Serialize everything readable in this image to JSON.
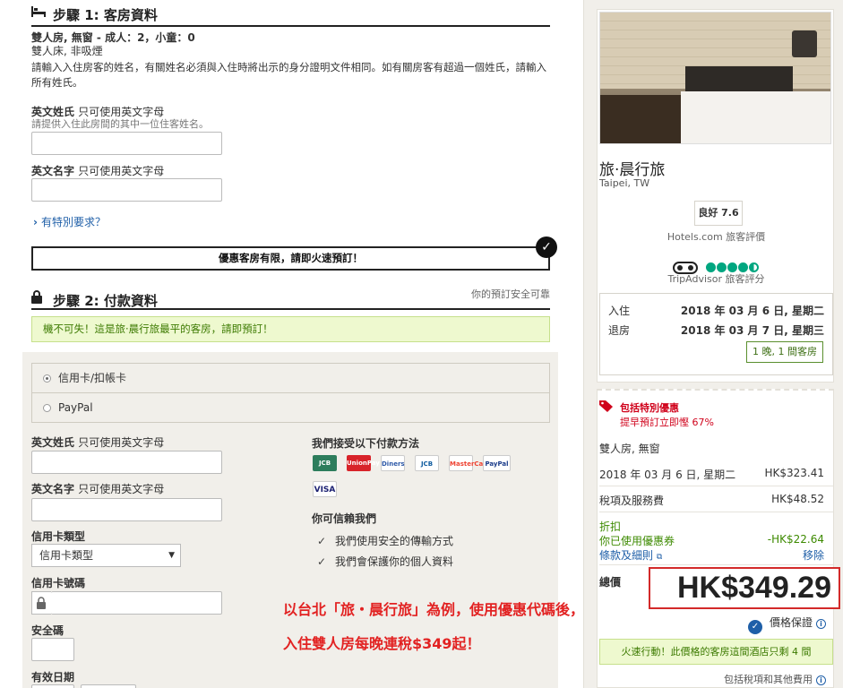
{
  "step1": {
    "title": "步驟 1: 客房資料",
    "room_title": "雙人房, 無窗 - 成人：2，小童：0",
    "room_bed": "雙人床, 非吸煙",
    "instruction": "請輸入入住房客的姓名，有關姓名必須與入住時將出示的身分證明文件相同。如有關房客有超過一個姓氏，請輸入所有姓氏。",
    "surname_label": "英文姓氏",
    "surname_sub": "只可使用英文字母",
    "surname_hint": "請提供入住此房間的其中一位住客姓名。",
    "givenname_label": "英文名字",
    "givenname_sub": "只可使用英文字母",
    "special_request": "有特別要求？",
    "promo_text": "優惠客房有限，請即火速預訂！"
  },
  "step2": {
    "title": "步驟 2: 付款資料",
    "secure_note": "你的預訂安全可靠",
    "green_note": "機不可失！這是旅·晨行旅最平的客房，請即預訂！",
    "option_card": "信用卡/扣帳卡",
    "option_paypal": "PayPal",
    "surname_label": "英文姓氏",
    "surname_sub": "只可使用英文字母",
    "givenname_label": "英文名字",
    "givenname_sub": "只可使用英文字母",
    "card_type_label": "信用卡類型",
    "card_type_value": "信用卡類型",
    "card_number_label": "信用卡號碼",
    "cvv_label": "安全碼",
    "expiry_label": "有效日期",
    "accept_title": "我們接受以下付款方法",
    "cards": [
      "JCB",
      "UnionPay",
      "Diners",
      "JCB",
      "MasterCard",
      "PayPal",
      "VISA"
    ],
    "trust_title": "你可信賴我們",
    "trust_items": [
      "我們使用安全的傳輸方式",
      "我們會保護你的個人資料"
    ]
  },
  "annotation": {
    "line1": "以台北「旅・晨行旅」為例，使用優惠代碼後，",
    "line2": "入住雙人房每晚連稅$349起！"
  },
  "hotel": {
    "name": "旅·晨行旅",
    "location": "Taipei, TW",
    "rating": "良好 7.6",
    "rating_source": "Hotels.com 旅客評價",
    "tripadvisor_source": "TripAdvisor 旅客評分",
    "tripadvisor_score": 4.5,
    "checkin_label": "入住",
    "checkin_value": "2018 年 03 月 6 日, 星期二",
    "checkout_label": "退房",
    "checkout_value": "2018 年 03 月 7 日, 星期三",
    "nights": "1 晚, 1 間客房"
  },
  "price": {
    "deal_title": "包括特別優惠",
    "deal_sub": "提早預訂立即慳 67%",
    "room": "雙人房, 無窗",
    "night_date": "2018 年 03 月 6 日, 星期二",
    "night_price": "HK$323.41",
    "tax_label": "稅項及服務費",
    "tax_value": "HK$48.52",
    "discount_label": "折扣",
    "coupon_label": "你已使用優惠券",
    "coupon_value": "-HK$22.64",
    "terms_label": "條款及細則",
    "remove_label": "移除",
    "total_label": "總價",
    "total_value": "HK$349.29",
    "guarantee": "價格保證",
    "hurry": "火速行動！此價格的客房這間酒店只剩 4 間",
    "included": "包括稅項和其他費用"
  },
  "colors": {
    "accent_red": "#d0021b",
    "link_blue": "#1f5fa8",
    "success_green": "#3c7a00",
    "note_bg": "#eef9cf"
  }
}
